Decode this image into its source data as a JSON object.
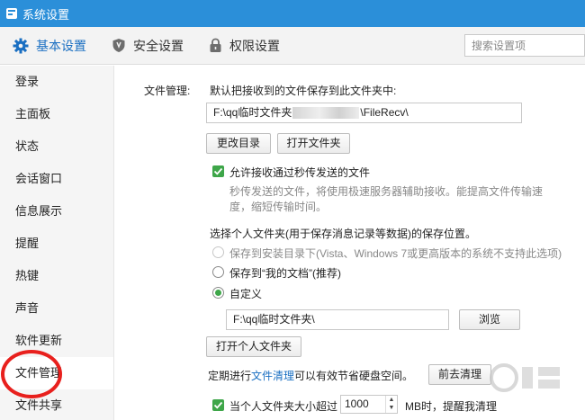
{
  "window": {
    "title": "系统设置"
  },
  "toolbar": {
    "tabs": [
      {
        "label": "基本设置",
        "icon": "gear-icon"
      },
      {
        "label": "安全设置",
        "icon": "shield-icon"
      },
      {
        "label": "权限设置",
        "icon": "lock-icon"
      }
    ],
    "search_placeholder": "搜索设置项"
  },
  "sidebar": {
    "items": [
      {
        "label": "登录"
      },
      {
        "label": "主面板"
      },
      {
        "label": "状态"
      },
      {
        "label": "会话窗口"
      },
      {
        "label": "信息展示"
      },
      {
        "label": "提醒"
      },
      {
        "label": "热键"
      },
      {
        "label": "声音"
      },
      {
        "label": "软件更新"
      },
      {
        "label": "文件管理"
      },
      {
        "label": "文件共享"
      }
    ],
    "selected": "文件管理"
  },
  "file_management": {
    "section_label": "文件管理:",
    "default_save_desc": "默认把接收到的文件保存到此文件夹中:",
    "save_path_prefix": "F:\\qq临时文件夹",
    "save_path_suffix": "\\FileRecv\\",
    "change_dir_button": "更改目录",
    "open_folder_button": "打开文件夹",
    "allow_instant_label": "允许接收通过秒传发送的文件",
    "allow_instant_checked": true,
    "instant_desc_line1": "秒传发送的文件，将使用极速服务器辅助接收。能提高文件传输速",
    "instant_desc_line2": "度，缩短传输时间。",
    "personal_folder_desc": "选择个人文件夹(用于保存消息记录等数据)的保存位置。",
    "radio_options": [
      {
        "label": "保存到安装目录下(Vista、Windows 7或更高版本的系统不支持此选项)",
        "disabled": true,
        "checked": false
      },
      {
        "label": "保存到“我的文档”(推荐)",
        "disabled": false,
        "checked": false
      },
      {
        "label": "自定义",
        "disabled": false,
        "checked": true
      }
    ],
    "custom_path": "F:\\qq临时文件夹\\",
    "browse_button": "浏览",
    "open_personal_button": "打开个人文件夹",
    "cleanup_prefix": "定期进行",
    "cleanup_link": "文件清理",
    "cleanup_suffix": "可以有效节省硬盘空间。",
    "cleanup_button": "前去清理",
    "size_limit_label": "当个人文件夹大小超过",
    "size_limit_value": "1000",
    "size_limit_unit": "MB时，提醒我清理",
    "size_limit_checked": true
  },
  "colors": {
    "titlebar": "#2b8fd9",
    "accent": "#1a6fc2",
    "check_green": "#3ea649",
    "annotation_red": "#e8201d"
  }
}
